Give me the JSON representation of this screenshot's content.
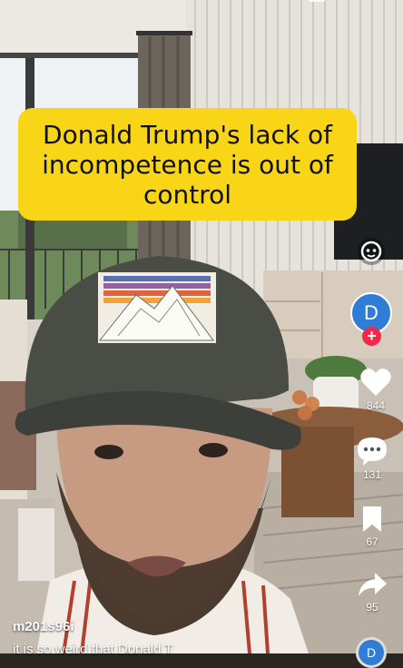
{
  "video": {
    "caption": "Donald Trump's lack of incompetence is out of control",
    "hat_text": "patagonia"
  },
  "creator": {
    "avatar_letter": "D",
    "username": "m201s96i",
    "description": "it is so weird that Donald T"
  },
  "actions": {
    "likes": "844",
    "comments": "131",
    "saves": "67",
    "shares": "95"
  },
  "icons": {
    "effect": "effect-face-icon",
    "follow": "plus-icon",
    "like": "heart-icon",
    "comment": "comment-bubble-icon",
    "save": "bookmark-icon",
    "share": "share-arrow-icon",
    "sound": "music-disc-icon"
  },
  "colors": {
    "caption_bg": "#f8d617",
    "avatar_bg": "#2f7dd6",
    "follow_plus": "#f0284a"
  }
}
